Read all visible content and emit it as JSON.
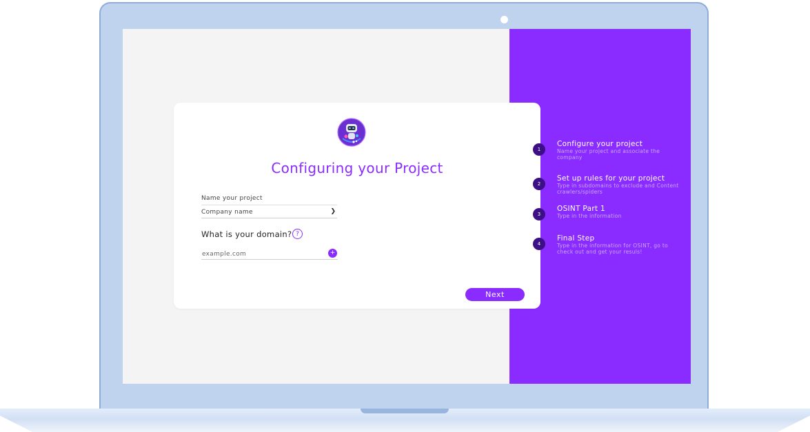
{
  "card": {
    "title": "Configuring your Project",
    "project_name_label": "Name your project",
    "company_select_value": "Company name",
    "domain_question": "What is your domain?",
    "help_symbol": "?",
    "domain_placeholder": "example.com",
    "add_symbol": "+",
    "next_label": "Next"
  },
  "steps": [
    {
      "number": "1",
      "title": "Configure your project",
      "description": "Name your project and associate the company"
    },
    {
      "number": "2",
      "title": "Set up rules for your project",
      "description": "Type in subdomains to exclude and Content crawlers/spiders"
    },
    {
      "number": "3",
      "title": "OSINT Part 1",
      "description": "Type in the information"
    },
    {
      "number": "4",
      "title": "Final Step",
      "description": "Type in the information for OSINT, go to check out and get your resuls!"
    }
  ],
  "icons": {
    "logo": "robot-logo-icon",
    "select": "chevron-down-icon"
  },
  "colors": {
    "accent": "#8a2cff",
    "step_circle": "#3d0f86",
    "step_description": "#c9a6ff",
    "screen_bg": "#f4f4f4",
    "laptop_frame": "#bfd3ef"
  }
}
